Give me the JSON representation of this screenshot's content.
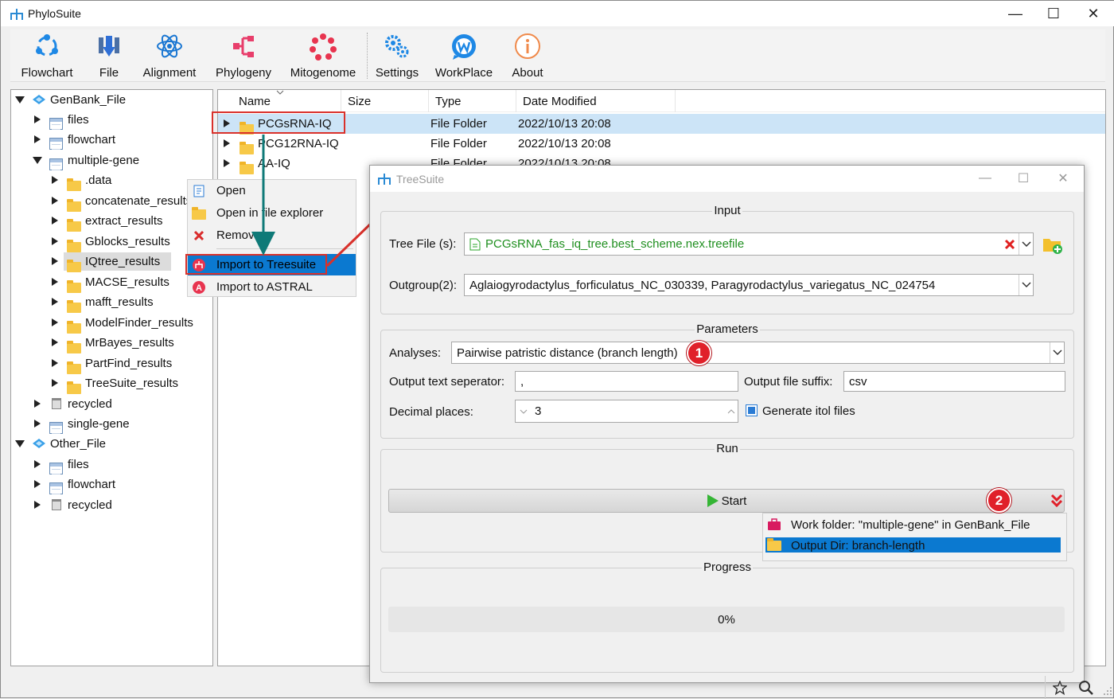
{
  "app": {
    "title": "PhyloSuite",
    "window_controls": {
      "minimize": "—",
      "maximize": "☐",
      "close": "✕"
    }
  },
  "toolbar": {
    "items": [
      {
        "label": "Flowchart",
        "icon": "flowchart-icon"
      },
      {
        "label": "File",
        "icon": "file-icon"
      },
      {
        "label": "Alignment",
        "icon": "alignment-icon"
      },
      {
        "label": "Phylogeny",
        "icon": "phylogeny-icon"
      },
      {
        "label": "Mitogenome",
        "icon": "mitogenome-icon"
      },
      {
        "label": "Settings",
        "icon": "settings-icon"
      },
      {
        "label": "WorkPlace",
        "icon": "workplace-icon"
      },
      {
        "label": "About",
        "icon": "about-icon"
      }
    ]
  },
  "tree": {
    "items": [
      {
        "label": "GenBank_File"
      },
      {
        "label": "files"
      },
      {
        "label": "flowchart"
      },
      {
        "label": "multiple-gene"
      },
      {
        "label": ".data"
      },
      {
        "label": "concatenate_results"
      },
      {
        "label": "extract_results"
      },
      {
        "label": "Gblocks_results"
      },
      {
        "label": "IQtree_results"
      },
      {
        "label": "MACSE_results"
      },
      {
        "label": "mafft_results"
      },
      {
        "label": "ModelFinder_results"
      },
      {
        "label": "MrBayes_results"
      },
      {
        "label": "PartFind_results"
      },
      {
        "label": "TreeSuite_results"
      },
      {
        "label": "recycled"
      },
      {
        "label": "single-gene"
      },
      {
        "label": "Other_File"
      },
      {
        "label": "files"
      },
      {
        "label": "flowchart"
      },
      {
        "label": "recycled"
      }
    ]
  },
  "file_list": {
    "columns": [
      "Name",
      "Size",
      "Type",
      "Date Modified"
    ],
    "rows": [
      {
        "name": "PCGsRNA-IQ",
        "size": "",
        "type": "File Folder",
        "date": "2022/10/13 20:08"
      },
      {
        "name": "PCG12RNA-IQ",
        "size": "",
        "type": "File Folder",
        "date": "2022/10/13 20:08"
      },
      {
        "name": "AA-IQ",
        "size": "",
        "type": "File Folder",
        "date": "2022/10/13 20:08"
      }
    ]
  },
  "context_menu": {
    "items": [
      {
        "label": "Open",
        "icon": "open-icon"
      },
      {
        "label": "Open in file explorer",
        "icon": "folder-icon"
      },
      {
        "label": "Remove",
        "icon": "remove-icon"
      },
      {
        "label": "Import to Treesuite",
        "icon": "treesuite-icon"
      },
      {
        "label": "Import to ASTRAL",
        "icon": "astral-icon"
      }
    ]
  },
  "treesuite": {
    "title": "TreeSuite",
    "input": {
      "group_title": "Input",
      "tree_file_label": "Tree File (s):",
      "tree_file_value": "PCGsRNA_fas_iq_tree.best_scheme.nex.treefile",
      "outgroup_label": "Outgroup(2):",
      "outgroup_value": "Aglaiogyrodactylus_forficulatus_NC_030339, Paragyrodactylus_variegatus_NC_024754"
    },
    "parameters": {
      "group_title": "Parameters",
      "analyses_label": "Analyses:",
      "analyses_value": "Pairwise patristic distance (branch length)",
      "sep_label": "Output text seperator:",
      "sep_value": ",",
      "suffix_label": "Output file suffix:",
      "suffix_value": "csv",
      "decimal_label": "Decimal places:",
      "decimal_value": "3",
      "itol_label": "Generate itol files",
      "itol_checked": true
    },
    "run": {
      "group_title": "Run",
      "start_label": "Start",
      "menu": [
        {
          "label": "Work folder: \"multiple-gene\" in GenBank_File"
        },
        {
          "label": "Output Dir: branch-length"
        }
      ]
    },
    "progress": {
      "group_title": "Progress",
      "value_text": "0%",
      "value": 0
    },
    "badges": [
      "1",
      "2"
    ]
  },
  "colors": {
    "accent": "#0b79d0",
    "selection": "#cce4f7",
    "annotation_red": "#d9312b",
    "arrow_teal": "#0f7a78",
    "tree_file_green": "#1f8f1f"
  }
}
